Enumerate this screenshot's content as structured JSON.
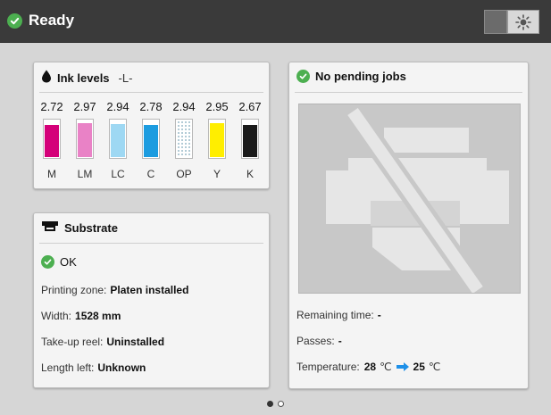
{
  "header": {
    "status": "Ready",
    "status_icon": "check-circle-icon",
    "status_color": "#4caf50",
    "brightness_icon": "sun-icon"
  },
  "ink": {
    "title": "Ink levels",
    "subtitle": "-L-",
    "title_icon": "ink-drop-icon",
    "cartridges": [
      {
        "label": "M",
        "value": "2.72",
        "color": "#d40079"
      },
      {
        "label": "LM",
        "value": "2.97",
        "color": "#e982c6"
      },
      {
        "label": "LC",
        "value": "2.94",
        "color": "#9ed8f3"
      },
      {
        "label": "C",
        "value": "2.78",
        "color": "#1c9ce0"
      },
      {
        "label": "OP",
        "value": "2.94",
        "color": "#ffffff"
      },
      {
        "label": "Y",
        "value": "2.95",
        "color": "#ffee00"
      },
      {
        "label": "K",
        "value": "2.67",
        "color": "#1a1a1a"
      }
    ]
  },
  "substrate": {
    "title": "Substrate",
    "title_icon": "substrate-icon",
    "status": "OK",
    "status_icon": "check-circle-icon",
    "rows": [
      {
        "label": "Printing zone:",
        "value": "Platen installed"
      },
      {
        "label": "Width:",
        "value": "1528 mm"
      },
      {
        "label": "Take-up reel:",
        "value": "Uninstalled"
      },
      {
        "label": "Length left:",
        "value": "Unknown"
      }
    ]
  },
  "jobs": {
    "title": "No pending jobs",
    "title_icon": "check-circle-icon",
    "illustration_icon": "no-jobs-printer-icon",
    "remaining_label": "Remaining time:",
    "remaining_value": "-",
    "passes_label": "Passes:",
    "passes_value": "-",
    "temperature_label": "Temperature:",
    "temp_current": "28",
    "temp_target": "25",
    "temp_unit": "℃"
  },
  "pager": {
    "pages": 2,
    "current": 1
  }
}
